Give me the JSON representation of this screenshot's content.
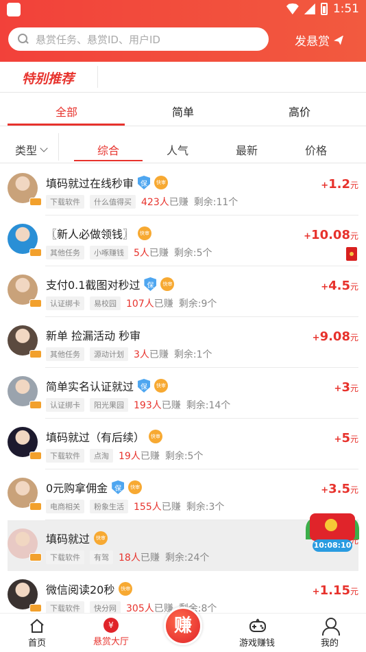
{
  "status": {
    "time": "1:51"
  },
  "search": {
    "placeholder": "悬赏任务、悬赏ID、用户ID"
  },
  "header": {
    "publish_label": "发悬赏"
  },
  "special": {
    "title": "特别推荐"
  },
  "tabs": [
    {
      "label": "全部",
      "active": true
    },
    {
      "label": "简单",
      "active": false
    },
    {
      "label": "高价",
      "active": false
    }
  ],
  "filters": {
    "type_label": "类型",
    "sorts": [
      {
        "label": "综合",
        "active": true
      },
      {
        "label": "人气",
        "active": false
      },
      {
        "label": "最新",
        "active": false
      },
      {
        "label": "价格",
        "active": false
      }
    ]
  },
  "badges": {
    "bao": "保",
    "kuai": "快审"
  },
  "tasks": [
    {
      "title": "填码就过在线秒审",
      "bao": true,
      "kuai": true,
      "tags": [
        "下载软件",
        "什么值得买"
      ],
      "earned_num": "423人",
      "earned_suffix": "已赚",
      "remaining": "剩余:11个",
      "price_plus": "+",
      "price": "1.2",
      "unit": "元",
      "avatar_color": "#c9a27a"
    },
    {
      "title": "〖新人必做领钱〗",
      "bao": false,
      "kuai": true,
      "tags": [
        "其他任务",
        "小啄赚钱"
      ],
      "earned_num": "5人",
      "earned_suffix": "已赚",
      "remaining": "剩余:5个",
      "price_plus": "+",
      "price": "10.08",
      "unit": "元",
      "avatar_color": "#2a8fd6",
      "redpacket": true
    },
    {
      "title": "支付0.1截图对秒过",
      "bao": true,
      "kuai": true,
      "tags": [
        "认证绑卡",
        "易校园"
      ],
      "earned_num": "107人",
      "earned_suffix": "已赚",
      "remaining": "剩余:9个",
      "price_plus": "+",
      "price": "4.5",
      "unit": "元",
      "avatar_color": "#c9a27a"
    },
    {
      "title": "新单 捡漏活动 秒审",
      "bao": false,
      "kuai": false,
      "tags": [
        "其他任务",
        "源动计划"
      ],
      "earned_num": "3人",
      "earned_suffix": "已赚",
      "remaining": "剩余:1个",
      "price_plus": "+",
      "price": "9.08",
      "unit": "元",
      "avatar_color": "#5b4a3f"
    },
    {
      "title": "简单实名认证就过",
      "bao": true,
      "kuai": true,
      "tags": [
        "认证绑卡",
        "阳光果园"
      ],
      "earned_num": "193人",
      "earned_suffix": "已赚",
      "remaining": "剩余:14个",
      "price_plus": "+",
      "price": "3",
      "unit": "元",
      "avatar_color": "#9aa3ad"
    },
    {
      "title": "填码就过（有后续）",
      "bao": false,
      "kuai": true,
      "tags": [
        "下载软件",
        "点淘"
      ],
      "earned_num": "19人",
      "earned_suffix": "已赚",
      "remaining": "剩余:5个",
      "price_plus": "+",
      "price": "5",
      "unit": "元",
      "avatar_color": "#1d1a2e"
    },
    {
      "title": "0元购拿佣金",
      "bao": true,
      "kuai": true,
      "tags": [
        "电商相关",
        "粉象生活"
      ],
      "earned_num": "155人",
      "earned_suffix": "已赚",
      "remaining": "剩余:3个",
      "price_plus": "+",
      "price": "3.5",
      "unit": "元",
      "avatar_color": "#c9a27a"
    },
    {
      "title": "填码就过",
      "bao": false,
      "kuai": true,
      "tags": [
        "下载软件",
        "有驾"
      ],
      "earned_num": "18人",
      "earned_suffix": "已赚",
      "remaining": "剩余:24个",
      "price_plus": "+",
      "price": "",
      "unit": "元",
      "avatar_color": "#e8c9c4",
      "highlight": true
    },
    {
      "title": "微信阅读20秒",
      "bao": false,
      "kuai": true,
      "tags": [
        "下载软件",
        "快分网"
      ],
      "earned_num": "305人",
      "earned_suffix": "已赚",
      "remaining": "剩余:8个",
      "price_plus": "+",
      "price": "1.15",
      "unit": "元",
      "avatar_color": "#3a3230"
    }
  ],
  "float_gift": {
    "timer": "10:08:10"
  },
  "bottom_nav": [
    {
      "label": "首页",
      "icon": "home-icon"
    },
    {
      "label": "悬赏大厅",
      "icon": "yen-icon",
      "active": true
    },
    {
      "label": "赚",
      "icon": "earn-icon"
    },
    {
      "label": "游戏赚钱",
      "icon": "gamepad-icon"
    },
    {
      "label": "我的",
      "icon": "user-icon"
    }
  ],
  "colors": {
    "brand": "#e7322c",
    "chip_bg": "#f2f2f2",
    "bao_blue": "#4ea6f0",
    "kuai_orange": "#f7a932"
  }
}
